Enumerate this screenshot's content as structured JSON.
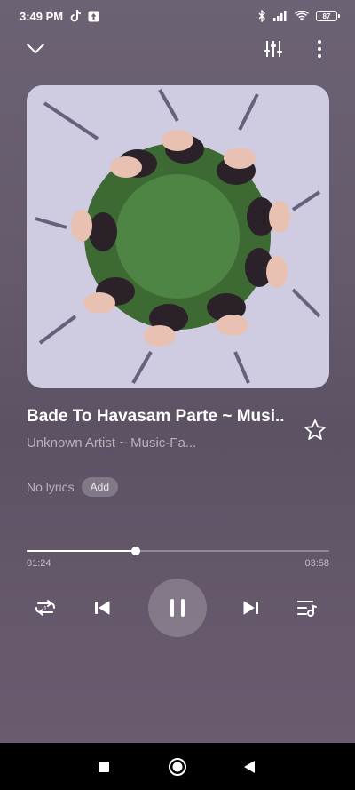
{
  "status_bar": {
    "time": "3:49 PM",
    "battery_level": "87",
    "icons": [
      "tiktok-icon",
      "upload-icon",
      "bluetooth-icon",
      "signal-icon",
      "wifi-icon",
      "battery-icon"
    ]
  },
  "player": {
    "song_title": "Bade To Havasam Parte ~ Musi..",
    "artist": "Unknown Artist ~ Music-Fa...",
    "no_lyrics_text": "No lyrics",
    "add_label": "Add",
    "current_time": "01:24",
    "total_time": "03:58",
    "progress": 0.36
  },
  "controls": [
    "repeat-one-icon",
    "previous-icon",
    "pause-icon",
    "next-icon",
    "queue-icon"
  ],
  "colors": {
    "background": "#645a6c",
    "accent": "#ffffff",
    "nav_bar": "#000000"
  }
}
